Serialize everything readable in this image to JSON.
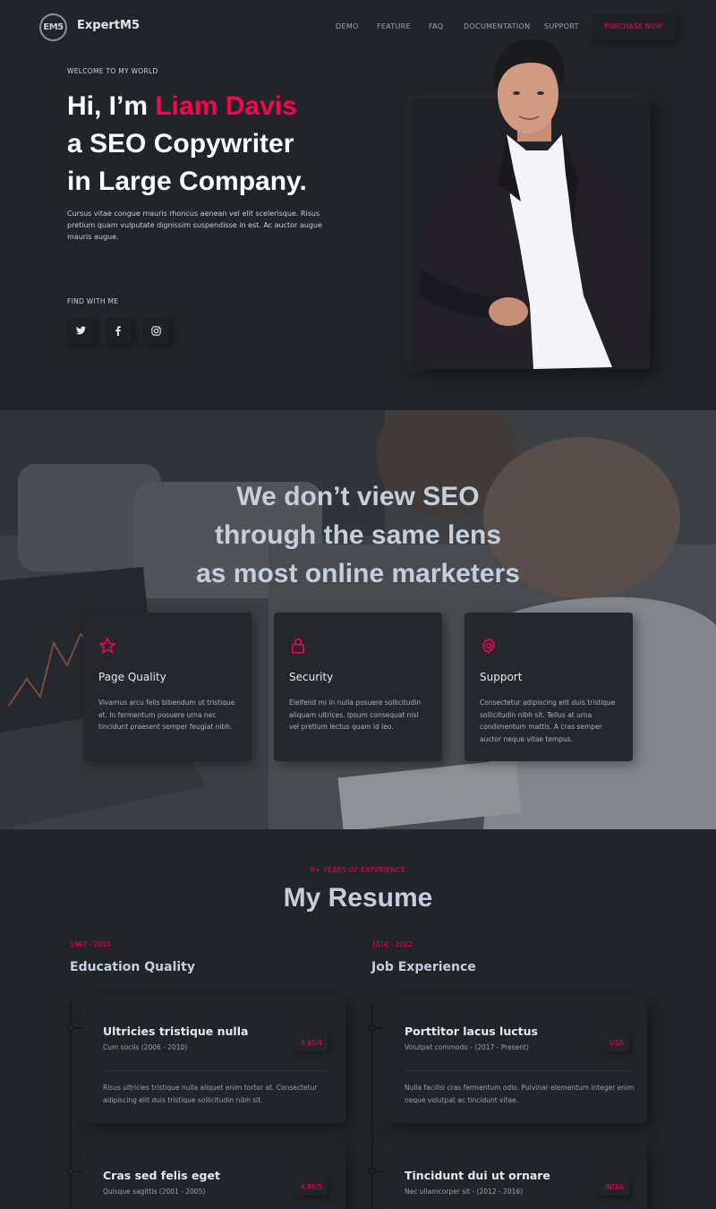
{
  "nav": {
    "logo": "EM5",
    "brand": "ExpertM5",
    "menu": [
      "DEMO",
      "FEATURE",
      "FAQ",
      "DOCUMENTATION",
      "SUPPORT"
    ],
    "cta": "PURCHASE NOW"
  },
  "hero": {
    "welcome": "WELCOME TO MY WORLD",
    "greeting": "Hi, I’m ",
    "name": "Liam Davis",
    "line2": "a SEO Copywriter",
    "line3": "in Large Company.",
    "description": "Cursus vitae congue mauris rhoncus aenean vel elit scelerisque. Risus pretium quam vulputate dignissim suspendisse in est. Ac auctor augue mauris augue.",
    "find_label": "FIND WITH ME",
    "social": [
      {
        "icon": "twitter-icon"
      },
      {
        "icon": "facebook-icon"
      },
      {
        "icon": "instagram-icon"
      }
    ]
  },
  "seo": {
    "title_lines": [
      "We don’t view SEO",
      "through the same lens",
      "as most online marketers"
    ],
    "cards": [
      {
        "icon": "star-icon",
        "title": "Page Quality",
        "text": "Vivamus arcu felis bibendum ut tristique et. In fermentum posuere urna nec tincidunt praesent semper feugiat nibh."
      },
      {
        "icon": "lock-icon",
        "title": "Security",
        "text": "Eleifend mi in nulla posuere sollicitudin aliquam ultrices. Ipsum consequat nisl vel pretium lectus quam id leo."
      },
      {
        "icon": "gear-icon",
        "title": "Support",
        "text": "Consectetur adipiscing elit duis tristique sollicitudin nibh sit. Tellus at urna condimentum mattis. A cras semper auctor neque vitae tempus."
      }
    ]
  },
  "resume": {
    "eyebrow": "9+ YEARS OF EXPERIENCE",
    "title": "My Resume",
    "education": {
      "period": "1997 - 2010",
      "title": "Education Quality",
      "items": [
        {
          "title": "Ultricies tristique nulla",
          "subtitle": "Cum sociis (2006 - 2010)",
          "badge": "3.95/4",
          "text": "Risus ultricies tristique nulla aliquet enim tortor at. Consectetur adipiscing elit duis tristique sollicitudin nibh sit."
        },
        {
          "title": "Cras sed felis eget",
          "subtitle": "Quisque sagittis (2001 - 2005)",
          "badge": "4.86/5",
          "text": ""
        }
      ]
    },
    "jobs": {
      "period": "2010 - 2022",
      "title": "Job Experience",
      "items": [
        {
          "title": "Porttitor lacus luctus",
          "subtitle": "Volutpat commodo - (2017 - Present)",
          "badge": "USA",
          "text": "Nulla facilisi cras fermentum odio. Pulvinar elementum integer enim neque volutpat ac tincidunt vitae."
        },
        {
          "title": "Tincidunt dui ut ornare",
          "subtitle": "Nec ullamcorper sit - (2012 - 2016)",
          "badge": "INDIA",
          "text": ""
        }
      ]
    }
  },
  "colors": {
    "accent": "#ff014f",
    "background": "#212428",
    "text": "#c4cfde"
  }
}
